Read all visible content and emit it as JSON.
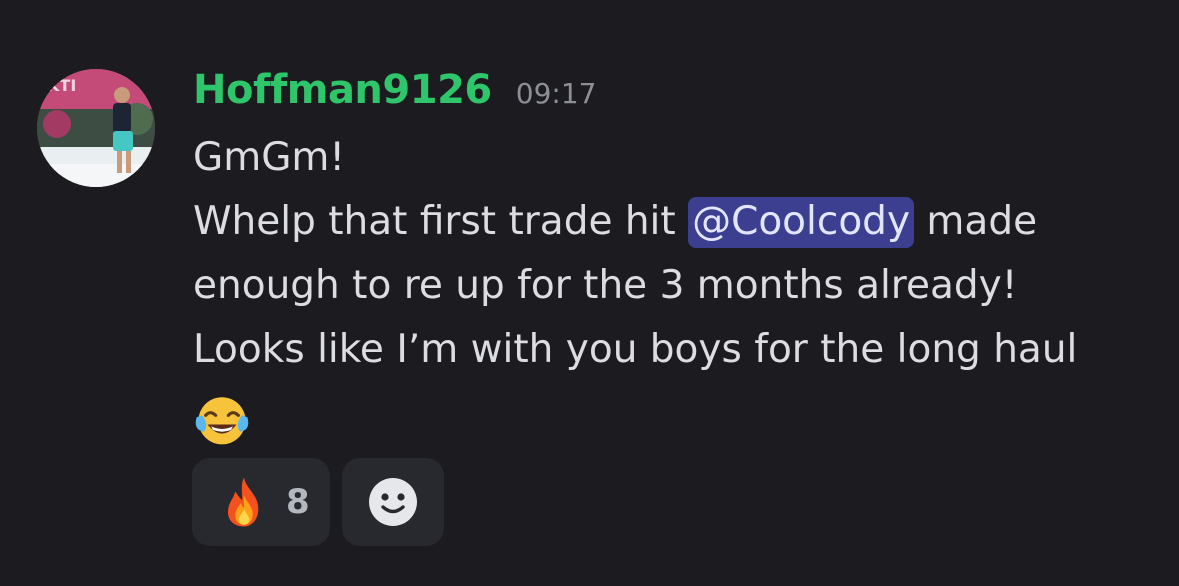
{
  "message": {
    "author": "Hoffman9126",
    "timestamp": "09:17",
    "lines": {
      "l1": "GmGm!",
      "l2_before": "Whelp that first trade hit ",
      "mention": "@Coolcody",
      "l2_after": " made",
      "l3": "enough to re up for the 3 months already!",
      "l4": "Looks like I’m with you boys for the long haul"
    },
    "inline_emoji": "face-with-tears-of-joy",
    "colors": {
      "background": "#1b1b20",
      "username": "#2fc56b",
      "mention_bg": "#3c3f8f",
      "text": "#dcdde2",
      "reaction_bg": "#28282f"
    }
  },
  "reactions": [
    {
      "emoji": "fire",
      "count": "8"
    },
    {
      "emoji": "add-reaction-smile"
    }
  ]
}
